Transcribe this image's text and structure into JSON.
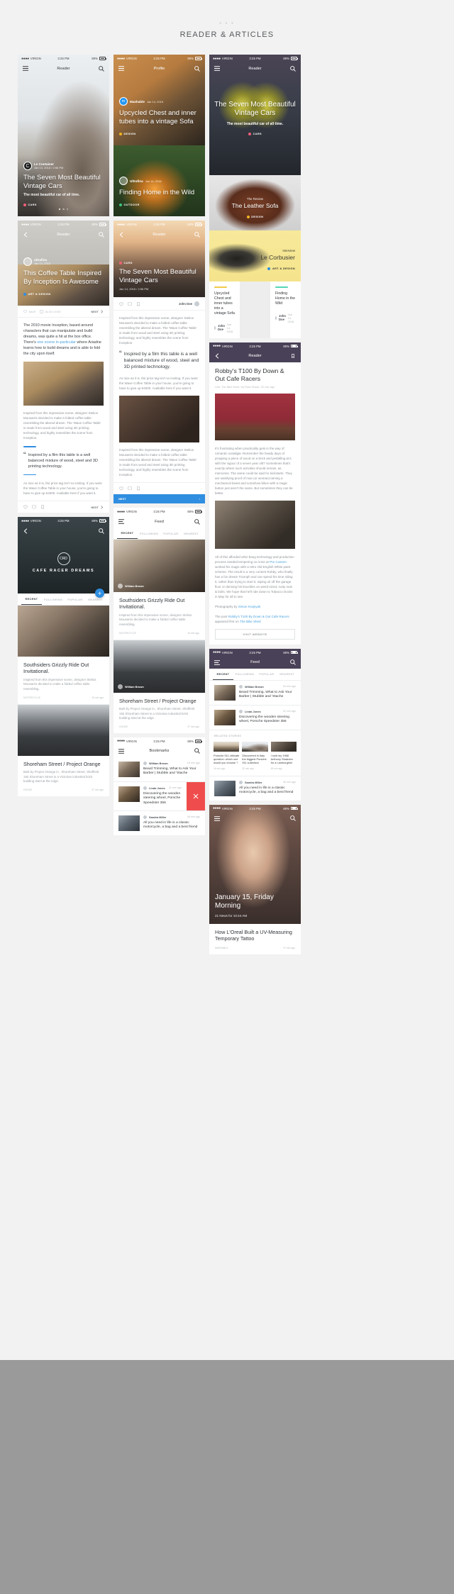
{
  "page": {
    "dots": "• • •",
    "title": "READER & ARTICLES"
  },
  "status": {
    "carrier": "VIRGIN",
    "dots": "●●●●",
    "time": "3:25 PM",
    "battery": "80%"
  },
  "nav": {
    "reader": "Reader",
    "feed": "Feed",
    "bookmarks": "Bookmarks",
    "profile": "Profile"
  },
  "icons": {
    "menu": "hamburger-menu-icon",
    "search": "search-icon",
    "back": "chevron-left-icon",
    "bookmark": "bookmark-icon",
    "heart": "heart-icon",
    "comment": "comment-icon",
    "share": "share-icon",
    "plus": "plus-icon",
    "close": "close-icon",
    "list": "list-icon"
  },
  "categories": {
    "cars": {
      "label": "CARS",
      "color": "#f5607a"
    },
    "design": {
      "label": "DESIGN",
      "color": "#f0b323"
    },
    "outdoor": {
      "label": "OUTDOOR",
      "color": "#3fc47d"
    },
    "art": {
      "label": "ART & DESIGN",
      "color": "#2f8ee0"
    }
  },
  "c1": {
    "s1": {
      "source": "Le Container",
      "source_initial": "C",
      "date": "Jan 14, 2016 / 2:56 PM",
      "title": "The Seven Most Beautiful Vintage Cars",
      "subtitle": "The most beautiful car of all time.",
      "category": "CARS"
    },
    "s2": {
      "source": "ultrafina",
      "date": "Jan 14, 2016",
      "title": "This Coffee Table Inspired By Inception Is Awesome",
      "category": "ART & DESIGN",
      "actions": {
        "save": "SAVE",
        "also_like": "ALSO LIKED",
        "next": "NEXT"
      },
      "para1_a": "The 2010 movie Inception, based around characters that can manipulate and build dreams, was quite a hit at the box office. There's ",
      "para1_link": "one scene in-particular",
      "para1_b": " where Ariadne learns how to build dreams and is able to fold the city upon itself.",
      "para2": "Inspired from this impressive scene, designer Stelios Mousarris decided to make a folded coffee table resembling the altered dream. The 'Wave Coffee Table' is made from wood and steel using 3D printing technology, and highly resembles the scene from Inception.",
      "quote": "Inspired by a film this table is a well balanced mixture of wood, steel and 3D printing technology.",
      "para3": "As nice as it is, the price tag isn't so inviting. If you want the Wave Coffee Table in your house, you're going to have to give up €4000. Available here if you want it."
    },
    "s3": {
      "brand_top": "CAFE RACER",
      "brand": "CAFE RACER DREAMS",
      "tabs": [
        "RECENT",
        "FOLLOWING",
        "POPULAR",
        "NEAREST"
      ],
      "item1": {
        "title": "Southsiders Grizzly Ride Out Invitational.",
        "body": "Inspired from this impressive scene, designer Stelios Mousarris decided to make a folded coffee table resembling.",
        "source": "MOTORCYCLE",
        "time": "16 min ago"
      },
      "item2": {
        "title": "Shoreham Street / Project Orange",
        "body": "Built by Project Orange in , Shoreham Street, Sheffield 192 Shoreham Street is a Victorian industrial brick building sited at the edge.",
        "source": "HOUSE",
        "time": "37 min ago"
      }
    }
  },
  "c2": {
    "s1": {
      "a": {
        "source": "Mashable",
        "date": "Jan 14, 2016",
        "title": "Upcycled Chest and inner tubes into a vintage Sofa",
        "category": "DESIGN"
      },
      "b": {
        "source": "Ultrafina",
        "date": "Jan 14, 2016",
        "title": "Finding Home in the Wild",
        "category": "OUTDOOR"
      }
    },
    "s2": {
      "category": "CARS",
      "title": "The Seven Most Beautiful Vintage Cars",
      "date": "Jan 14, 2016 / 2:56 PM",
      "author": "John Doe",
      "para1": "Inspired from this impressive scene, designer Stelios Mousarris decided to make a folded coffee table resembling the altered dream. The 'Wave Coffee Table' is made from wood and steel using 3D printing technology, and highly resembles the scene from Inception.",
      "quote": "Inspired by a film this table is a well balanced mixture of wood, steel and 3D printed technology.",
      "para2": "As nice as it is, the price tag isn't so inviting. If you want the Wave Coffee Table in your house, you're going to have to give up €4000. Available here if you want it.",
      "para3": "Inspired from this impressive scene, designer Stelios Mousarris decided to make a folded coffee table resembling the altered dream. The 'Wave Coffee Table' is made from wood and steel using 3D printing technology, and highly resembles the scene from Inception.",
      "next": "NEXT"
    },
    "s3": {
      "nav_title": "Feed",
      "tabs": [
        "RECENT",
        "FOLLOWING",
        "POPULAR",
        "NEAREST"
      ],
      "item1": {
        "name": "William Brown",
        "time": "16 min ago",
        "title": "Southsiders Grizzly Ride Out Invitational.",
        "body": "Inspired from this impressive scene, designer Stelios Mousarris decided to make a folded coffee table resembling.",
        "source": "MOTORCYCLE"
      },
      "item2": {
        "name": "William Brown",
        "time": "37 min ago",
        "title": "Shoreham Street / Project Orange",
        "body": "Built by Project Orange in , Shoreham Street, Sheffield 192 Shoreham Street is a Victorian industrial brick building sited at the edge.",
        "source": "HOUSE"
      }
    },
    "s4": {
      "nav_title": "Bookmarks",
      "rows": [
        {
          "name": "William Brown",
          "time": "16 min ago",
          "title": "Beard Trimming, What to Ask Your Barber | Stubble and 'Stache"
        },
        {
          "name": "Linda Jones",
          "time": "32 min ago",
          "title": "Discovering the wooden steering wheel, Porsche Speedster 356"
        },
        {
          "name": "Sandra Miller",
          "time": "48 min ago",
          "title": "All you need in life is a classic motorcycle, a bag and a best friend"
        }
      ]
    }
  },
  "c3": {
    "s1": {
      "hero": {
        "title": "The Seven Most Beautiful Vintage Cars",
        "subtitle": "The most beautiful car of all time.",
        "category": "CARS"
      },
      "sofa": {
        "kicker": "The Review",
        "title": "The Leather Sofa",
        "category": "DESIGN"
      },
      "corbusier": {
        "kicker": "Interview",
        "title": "Le Corbusier",
        "category": "ART & DESIGN"
      },
      "cards": [
        {
          "title": "Upcycled Chest and inner tubes into a vintage Sofa",
          "author": "John Doe",
          "date": "Jan 14, 2016",
          "accent": "#f0c94b"
        },
        {
          "title": "Finding Home in the Wild",
          "author": "John Doe",
          "date": "Jan 14, 2016",
          "accent": "#55d6b4"
        }
      ]
    },
    "s2": {
      "title": "Robby's T100 By Down & Out Cafe Racers",
      "meta": "Link: The Bike Shed / by Ross Sharp / 32 min ago",
      "para1": "It's frustrating when practicality gets in the way of romantic nostalgia. Remember the heady days of propping a piece of wood on a brick and pedalling at it with the vigour of a seven year old? Sometimes that's exactly where such activities should remain, as memories. The same could be said for kickstarts. They are satisfying proof of man (or woman) taming a mechanical beast and somehow bikes with a magic button just aren't the same. But sometimes they can be better.",
      "para2_a": "All of this afforded whiz-bang technology and production process needed tempering so Arnie at ",
      "para2_link1": "Pre Custom",
      "para2_b": " worked his magic with a retro Old English White paint scheme. The result is a very content Robby, who finally has a fox dream Triumph and can spend his time riding it, rather than trying to start it, wiping oil off the garage floor or deriving his knuckles on weird-sized, rusty nuts & bolts. We hope that he'll ride down to Tobacco Docks in May for all to see.",
      "photography_label": "Photography by ",
      "photography_name": "Simon Krajnyak",
      "credit_a": "The post ",
      "credit_link": "Robby's T100 By Down & Out Cafe Racers",
      "credit_b": " appeared first on ",
      "credit_link2": "The Bike Shed",
      "visit": "VISIT WEBSITE"
    },
    "s3": {
      "nav_title": "Feed",
      "tabs": [
        "RECENT",
        "FOLLOWING",
        "POPULAR",
        "NEAREST"
      ],
      "rows": [
        {
          "name": "William Brown",
          "time": "16 min ago",
          "title": "Beard Trimming, What to Ask Your Barber | Stubble and 'Stache"
        },
        {
          "name": "Linda Jones",
          "time": "32 min ago",
          "title": "Discovering the wooden steering wheel, Porsche Speedster 356"
        }
      ],
      "related_label": "RELATED STORIES",
      "related": [
        {
          "title": "Porsche 911 ultimate question: which one would you choose ?",
          "time": "16 min ago"
        },
        {
          "title": "Discovered in Italy the biggest Porsche 911 collection",
          "time": "32 min ago"
        },
        {
          "title": "I sold my 1968 Anthony Straddon for a Lamborghini",
          "time": "48 min ago"
        }
      ],
      "last": {
        "name": "Sandra Miller",
        "time": "48 min ago",
        "title": "All you need in life is a classic motorcycle, a bag and a best friend"
      }
    },
    "s4": {
      "headline": "January 15, Friday Morning",
      "sub": "21 News for 10:44 AM",
      "card_title": "How L'Oreal Built a UV-Measuring Temporary Tattoo",
      "card_source": "MASHABLE",
      "card_time": "37 min ago"
    }
  }
}
